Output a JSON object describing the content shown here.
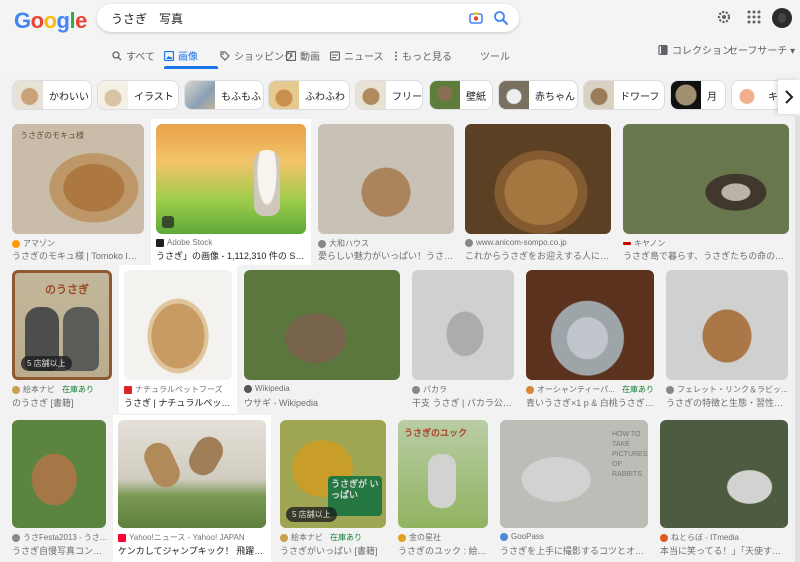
{
  "logo": {
    "text": "Google"
  },
  "search": {
    "query": "うさぎ　写真"
  },
  "tabs": [
    {
      "label": "すべて",
      "icon": "search-icon"
    },
    {
      "label": "画像",
      "icon": "image-icon"
    },
    {
      "label": "ショッピング",
      "icon": "tag-icon"
    },
    {
      "label": "動画",
      "icon": "play-icon"
    },
    {
      "label": "ニュース",
      "icon": "news-icon"
    },
    {
      "label": "もっと見る",
      "icon": "more-vert-icon"
    }
  ],
  "tools": {
    "label": "ツール"
  },
  "collection": {
    "label": "コレクション"
  },
  "safesearch": {
    "label": "セーフサーチ ▾"
  },
  "chips": [
    {
      "label": "かわいい"
    },
    {
      "label": "イラスト"
    },
    {
      "label": "もふもふ"
    },
    {
      "label": "ふわふわ"
    },
    {
      "label": "フリー"
    },
    {
      "label": "壁紙"
    },
    {
      "label": "赤ちゃん"
    },
    {
      "label": "ドワーフ"
    },
    {
      "label": "月"
    },
    {
      "label": "キ"
    }
  ],
  "results": [
    {
      "source": "アマゾン",
      "title": "うさぎのモキュ様 | Tomoko Imai |本",
      "banner": "うさぎのモキュ様"
    },
    {
      "source": "Adobe Stock",
      "title": "うさぎ」の画像 - 1,112,310 件の Stock 写..."
    },
    {
      "source": "大和ハウス",
      "title": "愛らしい魅力がいっぱい！うさぎと..."
    },
    {
      "source": "www.anicom-sompo.co.jp",
      "title": "これからうさぎをお迎えする人に読んで..."
    },
    {
      "source": "キヤノン",
      "title": "うさぎ島で暮らす、うさぎたちの命のきらめ..."
    },
    {
      "source": "絵本ナビ",
      "stock": "在庫あり",
      "title": "のうさぎ [書籍]",
      "banner": "のうさぎ",
      "badge": "5 店舗以上"
    },
    {
      "source": "ナチュラルペットフーズ",
      "title": "うさぎ | ナチュラルペットフ..."
    },
    {
      "source": "Wikipedia",
      "title": "ウサギ - Wikipedia"
    },
    {
      "source": "パカラ",
      "title": "干支 うさぎ | パカラ公式オ..."
    },
    {
      "source": "オーシャンティーパ...",
      "stock": "在庫あり",
      "title": "青いうさぎ×1 p & 白桃うさぎ×2 p..."
    },
    {
      "source": "フェレット・リンク＆ラビッ...",
      "title": "うさぎの特徴と生態・習性につい..."
    },
    {
      "source": "うさFesta2013 - うさ...",
      "title": "うさぎ自慢写真コンテス..."
    },
    {
      "source": "Yahoo!ニュース - Yahoo! JAPAN",
      "title": "ケンカしてジャンプキック！ 飛躍の卯年..."
    },
    {
      "source": "絵本ナビ",
      "stock": "在庫あり",
      "title": "うさぎがいっぱい [書籍]",
      "banner": "うさぎが いっぱい",
      "badge": "5 店舗以上"
    },
    {
      "source": "金の星社",
      "title": "うさぎのユック : 絵門...",
      "banner": "うさぎのユック"
    },
    {
      "source": "GooPass",
      "title": "うさぎを上手に撮影するコツとオススメ...",
      "banner": "HOW TO TAKE PICTURES OF RABBITS"
    },
    {
      "source": "ねとらぼ - ITmedia",
      "title": "本当に笑ってる！」「天使すぎる..."
    }
  ],
  "colors": {
    "accent": "#1a73e8",
    "stock": "#188038"
  }
}
